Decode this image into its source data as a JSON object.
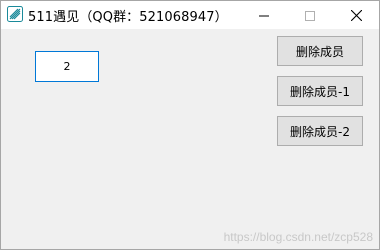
{
  "window": {
    "title": "511遇见（QQ群：521068947）",
    "app_icon": "app-logo-icon"
  },
  "controls": {
    "minimize_icon": "minimize-icon",
    "maximize_icon": "maximize-icon",
    "close_icon": "close-icon"
  },
  "main": {
    "number_value": "2",
    "buttons": [
      {
        "label": "删除成员"
      },
      {
        "label": "删除成员-1"
      },
      {
        "label": "删除成员-2"
      }
    ]
  },
  "watermark": {
    "text": "https://blog.csdn.net/zcp528"
  },
  "colors": {
    "accent": "#0078d7",
    "window_bg": "#f0f0f0",
    "button_bg": "#e1e1e1"
  }
}
